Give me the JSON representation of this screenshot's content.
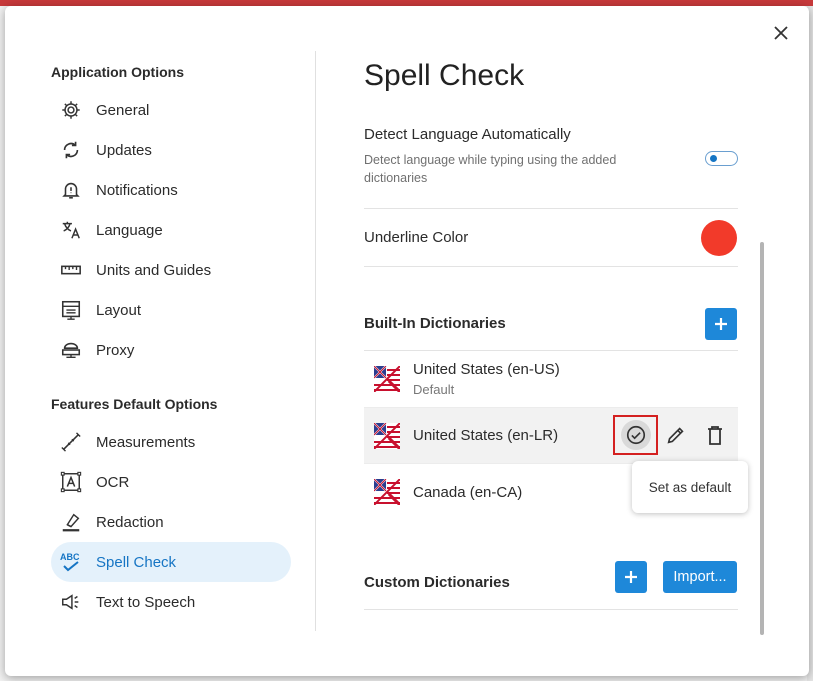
{
  "colors": {
    "accent": "#1e88d9",
    "active_bg": "#e4f1fb",
    "underline": "#f23a2a",
    "highlight": "#d42020"
  },
  "sidebar": {
    "app_options_title": "Application Options",
    "app_items": [
      {
        "label": "General",
        "icon": "gear-icon"
      },
      {
        "label": "Updates",
        "icon": "sync-icon"
      },
      {
        "label": "Notifications",
        "icon": "bell-icon"
      },
      {
        "label": "Language",
        "icon": "translate-icon"
      },
      {
        "label": "Units and Guides",
        "icon": "ruler-icon"
      },
      {
        "label": "Layout",
        "icon": "layout-icon"
      },
      {
        "label": "Proxy",
        "icon": "proxy-icon"
      }
    ],
    "features_title": "Features Default Options",
    "feature_items": [
      {
        "label": "Measurements",
        "icon": "measure-icon"
      },
      {
        "label": "OCR",
        "icon": "ocr-icon"
      },
      {
        "label": "Redaction",
        "icon": "eraser-icon"
      },
      {
        "label": "Spell Check",
        "icon": "spellcheck-icon",
        "active": true
      },
      {
        "label": "Text to Speech",
        "icon": "speaker-icon"
      }
    ]
  },
  "main": {
    "title": "Spell Check",
    "detect": {
      "title": "Detect Language Automatically",
      "description": "Detect language while typing using the added dictionaries",
      "enabled": true
    },
    "underline_label": "Underline Color",
    "builtin_label": "Built-In Dictionaries",
    "dictionaries": [
      {
        "name": "United States (en-US)",
        "sub": "Default"
      },
      {
        "name": "United States (en-LR)",
        "sub": ""
      },
      {
        "name": "Canada (en-CA)",
        "sub": ""
      }
    ],
    "tooltip": "Set as default",
    "custom_label": "Custom Dictionaries",
    "import_label": "Import..."
  }
}
